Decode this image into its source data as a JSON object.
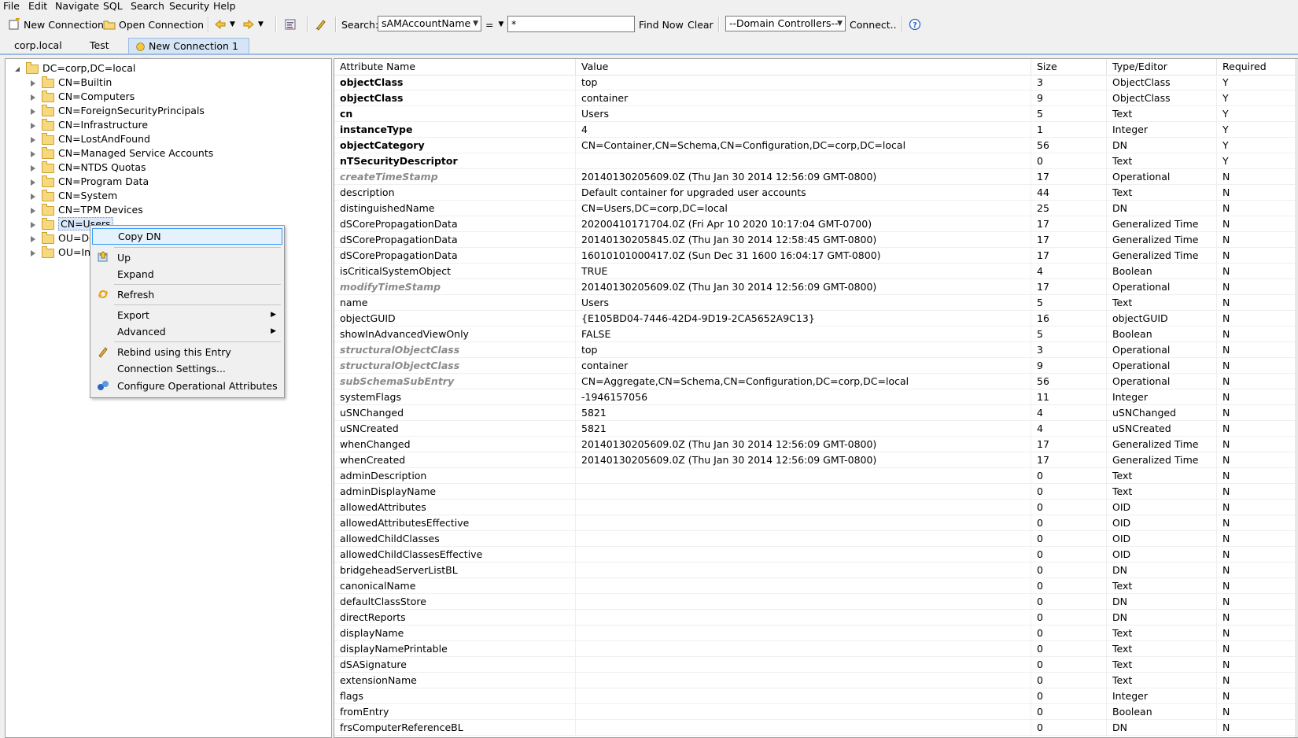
{
  "menu": [
    "File",
    "Edit",
    "Navigate",
    "SQL",
    "Search",
    "Security",
    "Help"
  ],
  "toolbar": {
    "new_connection": "New Connection",
    "open_connection": "Open Connection",
    "search_label": "Search:",
    "search_attr": "sAMAccountName",
    "operator": "=",
    "search_value": "*",
    "find_now": "Find Now",
    "clear": "Clear",
    "domain_controllers": "--Domain Controllers--",
    "connect": "Connect.."
  },
  "tabs": [
    "corp.local",
    "Test",
    "New Connection 1"
  ],
  "tree": {
    "root": "DC=corp,DC=local",
    "children": [
      "CN=Builtin",
      "CN=Computers",
      "CN=ForeignSecurityPrincipals",
      "CN=Infrastructure",
      "CN=LostAndFound",
      "CN=Managed Service Accounts",
      "CN=NTDS Quotas",
      "CN=Program Data",
      "CN=System",
      "CN=TPM Devices",
      "CN=Users",
      "OU=Dor",
      "OU=Infr"
    ]
  },
  "context_menu": {
    "copy_dn": "Copy DN",
    "up": "Up",
    "expand": "Expand",
    "refresh": "Refresh",
    "export": "Export",
    "advanced": "Advanced",
    "rebind": "Rebind using this Entry",
    "connection_settings": "Connection Settings...",
    "configure_operational": "Configure Operational Attributes"
  },
  "table": {
    "columns": [
      "Attribute Name",
      "Value",
      "Size",
      "Type/Editor",
      "Required"
    ],
    "rows": [
      {
        "name": "objectClass",
        "value": "top",
        "size": "3",
        "type": "ObjectClass",
        "req": "Y",
        "style": "bold"
      },
      {
        "name": "objectClass",
        "value": "container",
        "size": "9",
        "type": "ObjectClass",
        "req": "Y",
        "style": "bold"
      },
      {
        "name": "cn",
        "value": "Users",
        "size": "5",
        "type": "Text",
        "req": "Y",
        "style": "bold"
      },
      {
        "name": "instanceType",
        "value": "4",
        "size": "1",
        "type": "Integer",
        "req": "Y",
        "style": "bold"
      },
      {
        "name": "objectCategory",
        "value": "CN=Container,CN=Schema,CN=Configuration,DC=corp,DC=local",
        "size": "56",
        "type": "DN",
        "req": "Y",
        "style": "bold"
      },
      {
        "name": "nTSecurityDescriptor",
        "value": "",
        "size": "0",
        "type": "Text",
        "req": "Y",
        "style": "bold"
      },
      {
        "name": "createTimeStamp",
        "value": "20140130205609.0Z (Thu Jan 30 2014 12:56:09 GMT-0800)",
        "size": "17",
        "type": "Operational",
        "req": "N",
        "style": "oper"
      },
      {
        "name": "description",
        "value": "Default container for upgraded user accounts",
        "size": "44",
        "type": "Text",
        "req": "N",
        "style": ""
      },
      {
        "name": "distinguishedName",
        "value": "CN=Users,DC=corp,DC=local",
        "size": "25",
        "type": "DN",
        "req": "N",
        "style": ""
      },
      {
        "name": "dSCorePropagationData",
        "value": "20200410171704.0Z (Fri Apr 10 2020 10:17:04 GMT-0700)",
        "size": "17",
        "type": "Generalized Time",
        "req": "N",
        "style": ""
      },
      {
        "name": "dSCorePropagationData",
        "value": "20140130205845.0Z (Thu Jan 30 2014 12:58:45 GMT-0800)",
        "size": "17",
        "type": "Generalized Time",
        "req": "N",
        "style": ""
      },
      {
        "name": "dSCorePropagationData",
        "value": "16010101000417.0Z (Sun Dec 31 1600 16:04:17 GMT-0800)",
        "size": "17",
        "type": "Generalized Time",
        "req": "N",
        "style": ""
      },
      {
        "name": "isCriticalSystemObject",
        "value": "TRUE",
        "size": "4",
        "type": "Boolean",
        "req": "N",
        "style": ""
      },
      {
        "name": "modifyTimeStamp",
        "value": "20140130205609.0Z (Thu Jan 30 2014 12:56:09 GMT-0800)",
        "size": "17",
        "type": "Operational",
        "req": "N",
        "style": "oper"
      },
      {
        "name": "name",
        "value": "Users",
        "size": "5",
        "type": "Text",
        "req": "N",
        "style": ""
      },
      {
        "name": "objectGUID",
        "value": "{E105BD04-7446-42D4-9D19-2CA5652A9C13}",
        "size": "16",
        "type": "objectGUID",
        "req": "N",
        "style": ""
      },
      {
        "name": "showInAdvancedViewOnly",
        "value": "FALSE",
        "size": "5",
        "type": "Boolean",
        "req": "N",
        "style": ""
      },
      {
        "name": "structuralObjectClass",
        "value": "top",
        "size": "3",
        "type": "Operational",
        "req": "N",
        "style": "oper"
      },
      {
        "name": "structuralObjectClass",
        "value": "container",
        "size": "9",
        "type": "Operational",
        "req": "N",
        "style": "oper"
      },
      {
        "name": "subSchemaSubEntry",
        "value": "CN=Aggregate,CN=Schema,CN=Configuration,DC=corp,DC=local",
        "size": "56",
        "type": "Operational",
        "req": "N",
        "style": "oper"
      },
      {
        "name": "systemFlags",
        "value": "-1946157056",
        "size": "11",
        "type": "Integer",
        "req": "N",
        "style": ""
      },
      {
        "name": "uSNChanged",
        "value": "5821",
        "size": "4",
        "type": "uSNChanged",
        "req": "N",
        "style": ""
      },
      {
        "name": "uSNCreated",
        "value": "5821",
        "size": "4",
        "type": "uSNCreated",
        "req": "N",
        "style": ""
      },
      {
        "name": "whenChanged",
        "value": "20140130205609.0Z (Thu Jan 30 2014 12:56:09 GMT-0800)",
        "size": "17",
        "type": "Generalized Time",
        "req": "N",
        "style": ""
      },
      {
        "name": "whenCreated",
        "value": "20140130205609.0Z (Thu Jan 30 2014 12:56:09 GMT-0800)",
        "size": "17",
        "type": "Generalized Time",
        "req": "N",
        "style": ""
      },
      {
        "name": "adminDescription",
        "value": "",
        "size": "0",
        "type": "Text",
        "req": "N",
        "style": ""
      },
      {
        "name": "adminDisplayName",
        "value": "",
        "size": "0",
        "type": "Text",
        "req": "N",
        "style": ""
      },
      {
        "name": "allowedAttributes",
        "value": "",
        "size": "0",
        "type": "OID",
        "req": "N",
        "style": ""
      },
      {
        "name": "allowedAttributesEffective",
        "value": "",
        "size": "0",
        "type": "OID",
        "req": "N",
        "style": ""
      },
      {
        "name": "allowedChildClasses",
        "value": "",
        "size": "0",
        "type": "OID",
        "req": "N",
        "style": ""
      },
      {
        "name": "allowedChildClassesEffective",
        "value": "",
        "size": "0",
        "type": "OID",
        "req": "N",
        "style": ""
      },
      {
        "name": "bridgeheadServerListBL",
        "value": "",
        "size": "0",
        "type": "DN",
        "req": "N",
        "style": ""
      },
      {
        "name": "canonicalName",
        "value": "",
        "size": "0",
        "type": "Text",
        "req": "N",
        "style": ""
      },
      {
        "name": "defaultClassStore",
        "value": "",
        "size": "0",
        "type": "DN",
        "req": "N",
        "style": ""
      },
      {
        "name": "directReports",
        "value": "",
        "size": "0",
        "type": "DN",
        "req": "N",
        "style": ""
      },
      {
        "name": "displayName",
        "value": "",
        "size": "0",
        "type": "Text",
        "req": "N",
        "style": ""
      },
      {
        "name": "displayNamePrintable",
        "value": "",
        "size": "0",
        "type": "Text",
        "req": "N",
        "style": ""
      },
      {
        "name": "dSASignature",
        "value": "",
        "size": "0",
        "type": "Text",
        "req": "N",
        "style": ""
      },
      {
        "name": "extensionName",
        "value": "",
        "size": "0",
        "type": "Text",
        "req": "N",
        "style": ""
      },
      {
        "name": "flags",
        "value": "",
        "size": "0",
        "type": "Integer",
        "req": "N",
        "style": ""
      },
      {
        "name": "fromEntry",
        "value": "",
        "size": "0",
        "type": "Boolean",
        "req": "N",
        "style": ""
      },
      {
        "name": "frsComputerReferenceBL",
        "value": "",
        "size": "0",
        "type": "DN",
        "req": "N",
        "style": ""
      }
    ]
  }
}
